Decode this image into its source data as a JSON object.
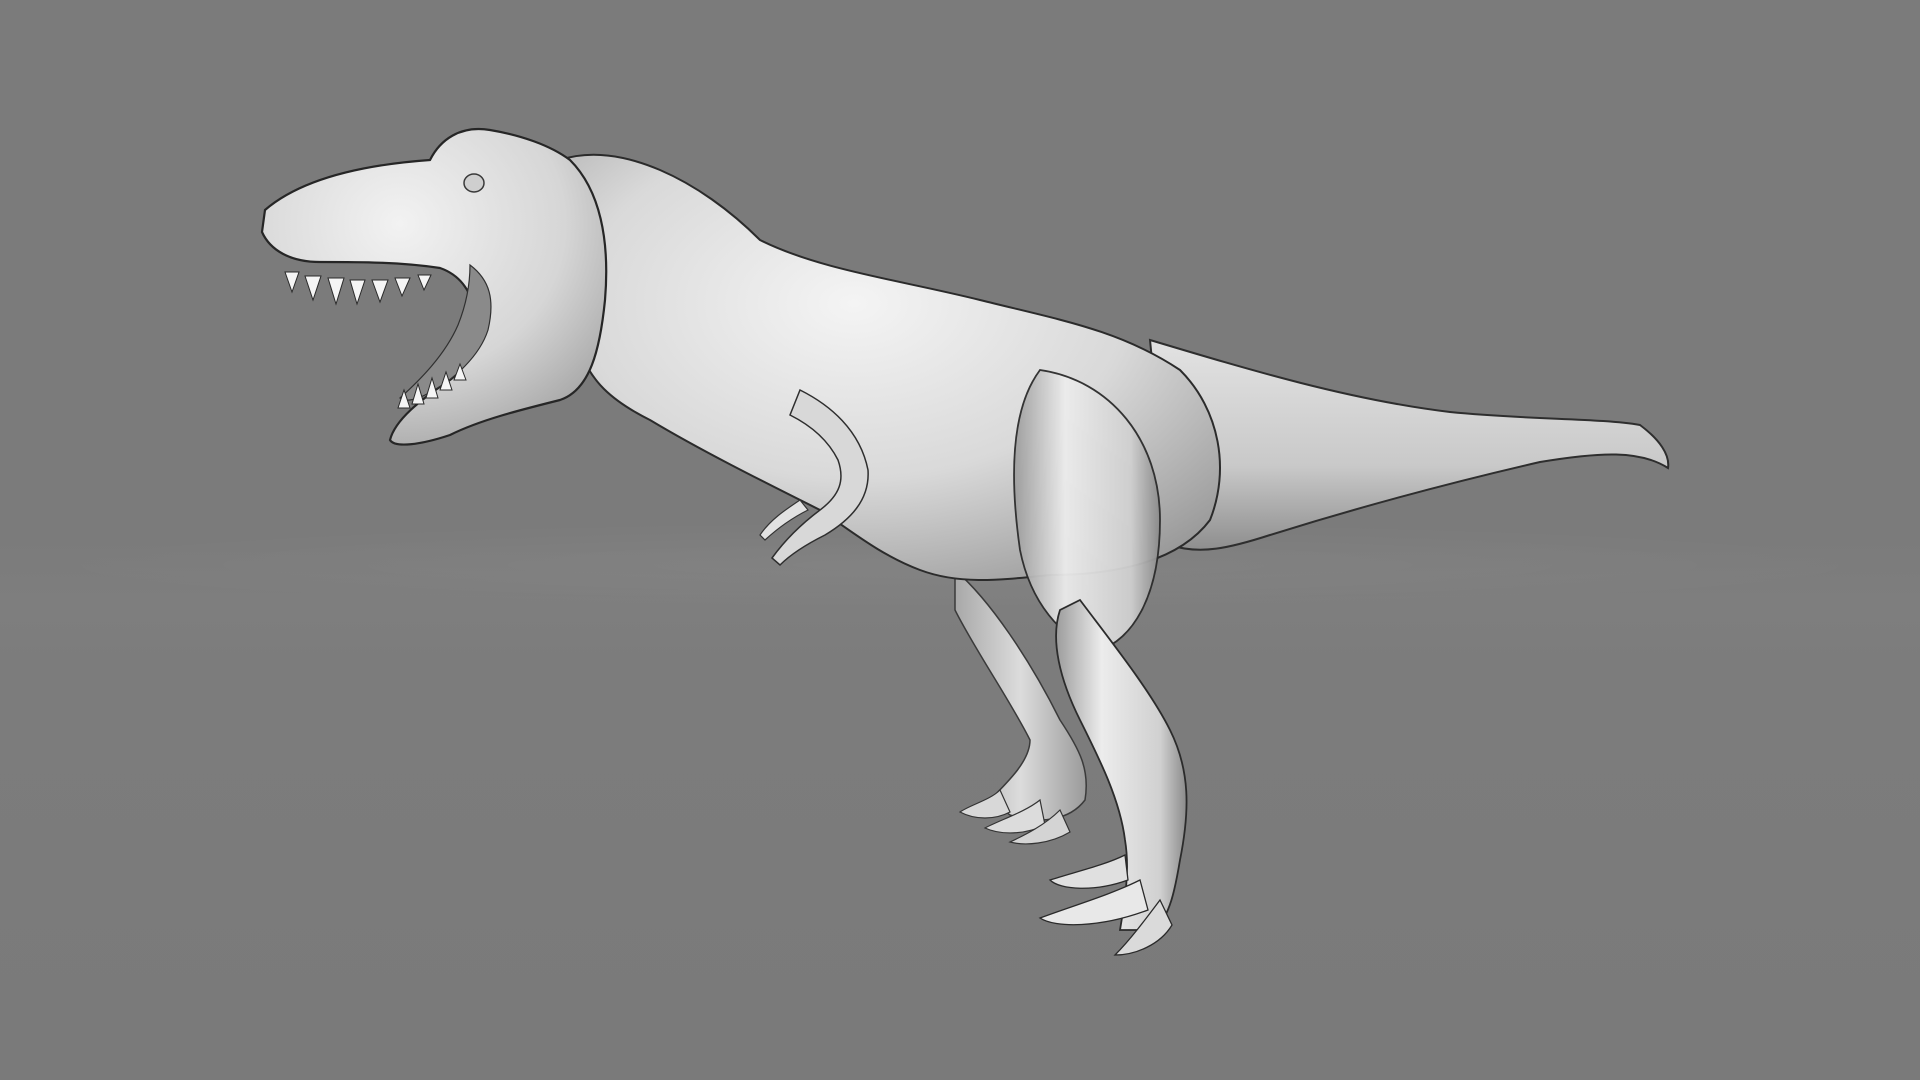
{
  "scene": {
    "subject": "t-rex-model",
    "background_color": "#7a7a7a",
    "model_color": "#e6e6e6",
    "shadow_color": "#2a2a2a"
  }
}
